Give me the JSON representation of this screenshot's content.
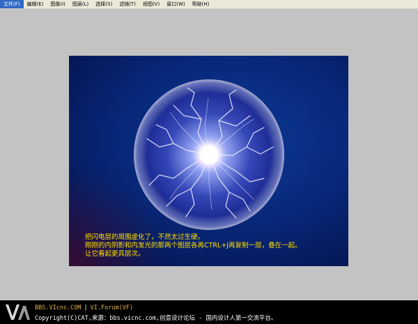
{
  "menu": {
    "items": [
      "文件(F)",
      "编辑(E)",
      "图像(I)",
      "图层(L)",
      "选择(S)",
      "滤镜(T)",
      "视图(V)",
      "窗口(W)",
      "帮助(H)"
    ]
  },
  "caption": {
    "line1": "把闪电层的周围虚化了，不然太过生硬。",
    "line2": "刚刚的内阴影和内发光的那两个图层各再CTRL+J再复制一层，叠在一起。",
    "line3": "让它看起更具层次。"
  },
  "footer": {
    "line1_site": "BBS.VIcnc.COM",
    "line1_sep": "|",
    "line1_forum": "VI.Forum(VF)",
    "line2": "Copyright(C)CAT,来源：bbs.vicnc.com,创意设计论坛 - 国内设计人第一交流平台。"
  },
  "colors": {
    "caption_text": "#ffe000",
    "footer_highlight": "#e8b24a",
    "canvas_bg": "#08287a"
  }
}
